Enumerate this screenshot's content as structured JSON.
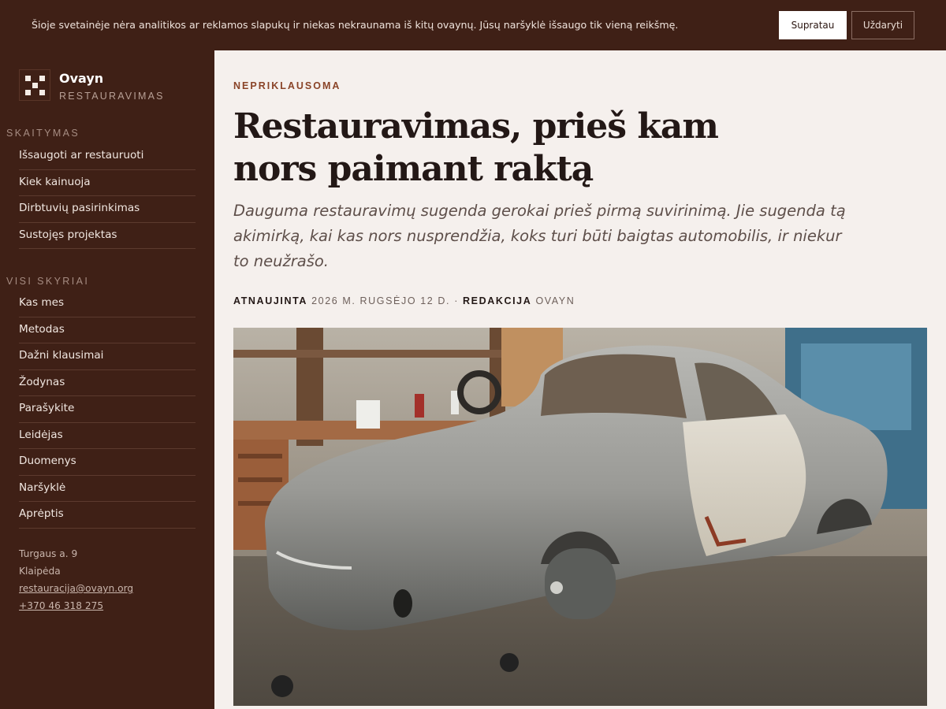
{
  "cookie_banner": {
    "text": "Šioje svetainėje nėra analitikos ar reklamos slapukų ir niekas nekraunama iš kitų ovaynų. Jūsų naršyklė išsaugo tik vieną reikšmę.",
    "accept_label": "Supratau",
    "close_label": "Uždaryti"
  },
  "brand": {
    "name": "Ovayn",
    "subtitle": "RESTAURAVIMAS"
  },
  "nav": {
    "reading_heading": "SKAITYMAS",
    "reading_items": [
      {
        "label": "Išsaugoti ar restauruoti"
      },
      {
        "label": "Kiek kainuoja"
      },
      {
        "label": "Dirbtuvių pasirinkimas"
      },
      {
        "label": "Sustojęs projektas"
      }
    ],
    "sections_heading": "VISI SKYRIAI",
    "section_items": [
      {
        "label": "Kas mes"
      },
      {
        "label": "Metodas"
      },
      {
        "label": "Dažni klausimai"
      },
      {
        "label": "Žodynas"
      },
      {
        "label": "Parašykite"
      },
      {
        "label": "Leidėjas"
      },
      {
        "label": "Duomenys"
      },
      {
        "label": "Naršyklė"
      },
      {
        "label": "Aprėptis"
      }
    ]
  },
  "contact": {
    "street": "Turgaus a. 9",
    "city": "Klaipėda",
    "email": "restauracija@ovayn.org",
    "phone": "+370 46 318 275"
  },
  "article": {
    "kicker": "NEPRIKLAUSOMA",
    "title": "Restauravimas, prieš kam nors paimant raktą",
    "lede": "Dauguma restauravimų sugenda gerokai prieš pirmą suvirinimą. Jie sugenda tą akimirką, kai kas nors nusprendžia, koks turi būti baigtas automobilis, ir niekur to neužrašo.",
    "meta": {
      "updated_label": "ATNAUJINTA",
      "updated_value": "2026 M. RUGSĖJO 12 D.",
      "separator": "·",
      "editor_label": "REDAKCIJA",
      "editor_value": "OVAYN"
    }
  },
  "colors": {
    "sidebar_bg": "#3f2016",
    "main_bg": "#f5f0ed",
    "accent": "#8a4428",
    "title": "#231816"
  }
}
